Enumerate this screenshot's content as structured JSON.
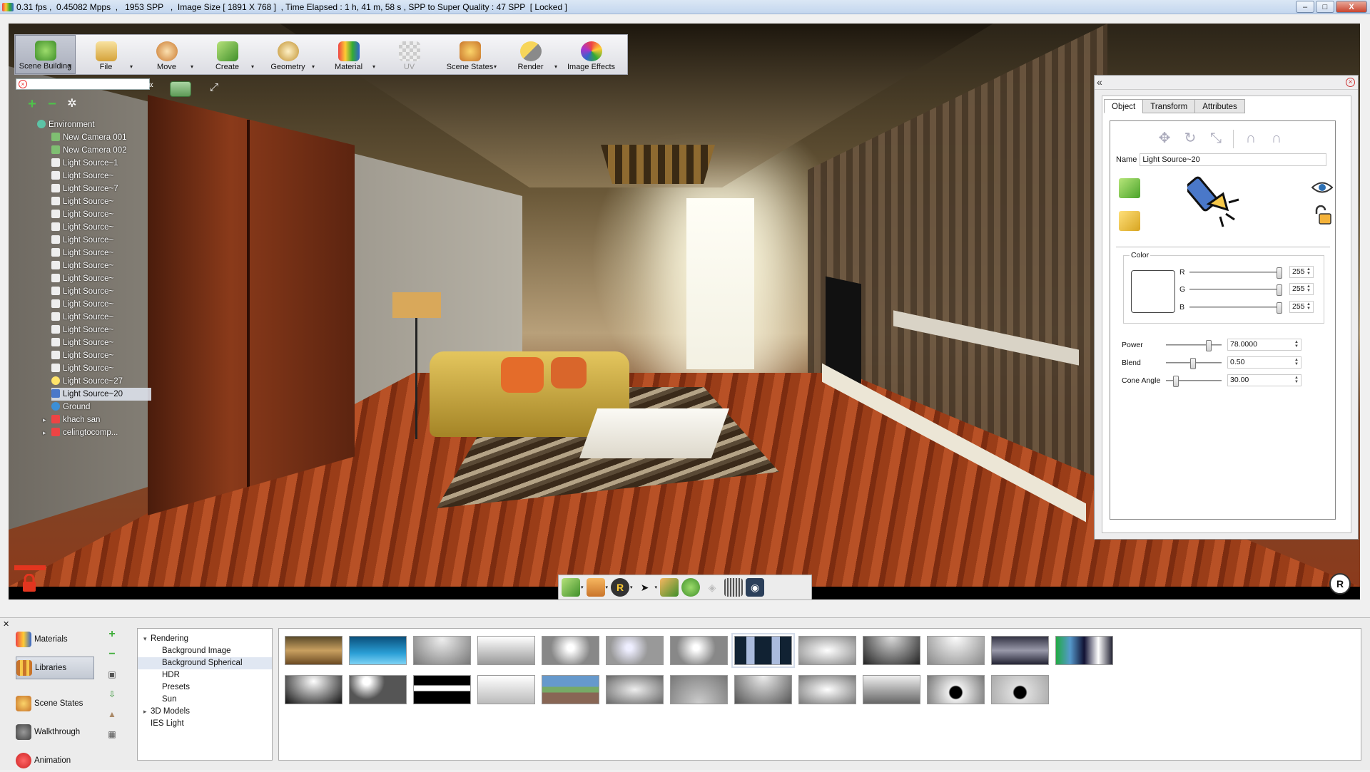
{
  "window": {
    "title": "0.31 fps ,  0.45082 Mpps  ,   1953 SPP   ,  Image Size [ 1891 X 768 ]  , Time Elapsed : 1 h, 41 m, 58 s , SPP to Super Quality : 47 SPP  [ Locked ]",
    "min": "–",
    "max": "□",
    "close": "X"
  },
  "toolbar": {
    "items": [
      {
        "label": "Scene Building",
        "icon": "scene-building-icon",
        "active": true
      },
      {
        "label": "File",
        "icon": "file-icon"
      },
      {
        "label": "Move",
        "icon": "move-icon"
      },
      {
        "label": "Create",
        "icon": "create-icon"
      },
      {
        "label": "Geometry",
        "icon": "geometry-icon"
      },
      {
        "label": "Material",
        "icon": "material-icon"
      },
      {
        "label": "UV",
        "icon": "uv-icon",
        "disabled": true
      },
      {
        "label": "Scene States",
        "icon": "scene-states-icon"
      },
      {
        "label": "Render",
        "icon": "render-icon"
      },
      {
        "label": "Image Effects",
        "icon": "image-effects-icon"
      }
    ]
  },
  "search": {
    "placeholder": ""
  },
  "scene_tree": {
    "items": [
      {
        "label": "Environment",
        "indent": 0,
        "icon": "environment-icon"
      },
      {
        "label": "New Camera 001",
        "indent": 1,
        "icon": "camera-icon"
      },
      {
        "label": "New Camera 002",
        "indent": 1,
        "icon": "camera-icon"
      },
      {
        "label": "Light Source~1",
        "indent": 1,
        "icon": "light-icon"
      },
      {
        "label": "Light Source~",
        "indent": 1,
        "icon": "light-icon"
      },
      {
        "label": "Light Source~7",
        "indent": 1,
        "icon": "light-icon"
      },
      {
        "label": "Light Source~",
        "indent": 1,
        "icon": "light-icon"
      },
      {
        "label": "Light Source~",
        "indent": 1,
        "icon": "light-icon"
      },
      {
        "label": "Light Source~",
        "indent": 1,
        "icon": "light-icon"
      },
      {
        "label": "Light Source~",
        "indent": 1,
        "icon": "light-icon"
      },
      {
        "label": "Light Source~",
        "indent": 1,
        "icon": "light-icon"
      },
      {
        "label": "Light Source~",
        "indent": 1,
        "icon": "light-icon"
      },
      {
        "label": "Light Source~",
        "indent": 1,
        "icon": "light-icon"
      },
      {
        "label": "Light Source~",
        "indent": 1,
        "icon": "light-icon"
      },
      {
        "label": "Light Source~",
        "indent": 1,
        "icon": "light-icon"
      },
      {
        "label": "Light Source~",
        "indent": 1,
        "icon": "light-icon"
      },
      {
        "label": "Light Source~",
        "indent": 1,
        "icon": "light-icon"
      },
      {
        "label": "Light Source~",
        "indent": 1,
        "icon": "light-icon"
      },
      {
        "label": "Light Source~",
        "indent": 1,
        "icon": "light-icon"
      },
      {
        "label": "Light Source~",
        "indent": 1,
        "icon": "light-icon"
      },
      {
        "label": "Light Source~27",
        "indent": 1,
        "icon": "bulb-icon"
      },
      {
        "label": "Light Source~20",
        "indent": 1,
        "icon": "flashlight-icon",
        "selected": true
      },
      {
        "label": "Ground",
        "indent": 1,
        "icon": "ground-icon"
      },
      {
        "label": "khach san",
        "indent": 1,
        "icon": "group-icon",
        "expandable": true
      },
      {
        "label": "celingtocomp...",
        "indent": 1,
        "icon": "group-icon",
        "expandable": true
      }
    ]
  },
  "properties": {
    "tabs": [
      "Object",
      "Transform",
      "Attributes"
    ],
    "active_tab": "Object",
    "name_label": "Name",
    "name_value": "Light Source~20",
    "color_label": "Color",
    "r_label": "R",
    "g_label": "G",
    "b_label": "B",
    "r": "255",
    "g": "255",
    "b": "255",
    "power_label": "Power",
    "power": "78.0000",
    "blend_label": "Blend",
    "blend": "0.50",
    "cone_label": "Cone Angle",
    "cone": "30.00",
    "colors": {
      "swatch": "#ffffff"
    }
  },
  "bottom": {
    "side_items": [
      {
        "label": "Materials",
        "icon": "materials-icon"
      },
      {
        "label": "Libraries",
        "icon": "libraries-icon",
        "active": true
      },
      {
        "label": "Scene States",
        "icon": "scene-states-icon"
      },
      {
        "label": "Walkthrough",
        "icon": "walkthrough-icon"
      },
      {
        "label": "Animation",
        "icon": "animation-icon"
      }
    ],
    "tree": [
      {
        "label": "Rendering",
        "level": 0,
        "expand": "▾"
      },
      {
        "label": "Background Image",
        "level": 2
      },
      {
        "label": "Background Spherical",
        "level": 2,
        "selected": true
      },
      {
        "label": "HDR",
        "level": 2
      },
      {
        "label": "Presets",
        "level": 2
      },
      {
        "label": "Sun",
        "level": 2
      },
      {
        "label": "3D Models",
        "level": 0,
        "expand": "▸"
      },
      {
        "label": "IES Light",
        "level": 0
      }
    ]
  }
}
